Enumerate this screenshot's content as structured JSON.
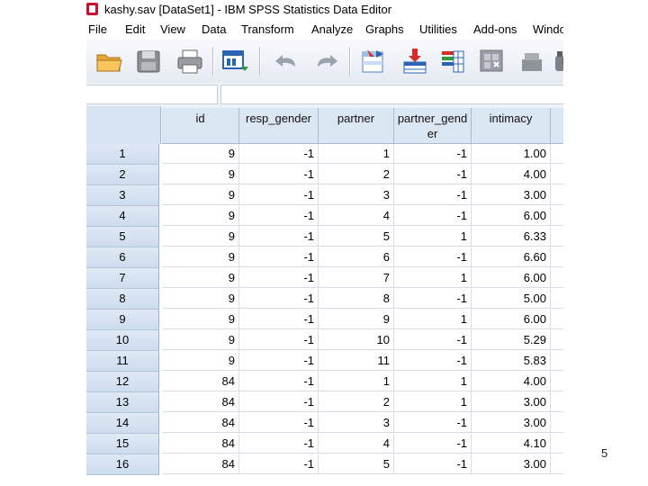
{
  "window": {
    "title": "kashy.sav [DataSet1] - IBM SPSS Statistics Data Editor"
  },
  "menubar": {
    "items": [
      "File",
      "Edit",
      "View",
      "Data",
      "Transform",
      "Analyze",
      "Graphs",
      "Utilities",
      "Add-ons",
      "Windo"
    ]
  },
  "toolbar": {
    "buttons": [
      "open-folder-icon",
      "save-disk-icon",
      "print-icon",
      "dialog-recall-icon",
      "undo-icon",
      "redo-icon",
      "goto-case-icon",
      "insert-cases-icon",
      "insert-variable-icon",
      "split-file-icon",
      "weight-cases-icon",
      "find-binoculars-icon"
    ]
  },
  "cellbar": {
    "reference": "",
    "value": ""
  },
  "grid": {
    "columns": [
      "id",
      "resp_gender",
      "partner",
      "partner_gend er",
      "intimacy"
    ],
    "column_header_lines": [
      [
        "id"
      ],
      [
        "resp_gender"
      ],
      [
        "partner"
      ],
      [
        "partner_gend",
        "er"
      ],
      [
        "intimacy"
      ]
    ],
    "rows": [
      {
        "n": "1",
        "id": "9",
        "resp_gender": "-1",
        "partner": "1",
        "partner_gender": "-1",
        "intimacy": "1.00"
      },
      {
        "n": "2",
        "id": "9",
        "resp_gender": "-1",
        "partner": "2",
        "partner_gender": "-1",
        "intimacy": "4.00"
      },
      {
        "n": "3",
        "id": "9",
        "resp_gender": "-1",
        "partner": "3",
        "partner_gender": "-1",
        "intimacy": "3.00"
      },
      {
        "n": "4",
        "id": "9",
        "resp_gender": "-1",
        "partner": "4",
        "partner_gender": "-1",
        "intimacy": "6.00"
      },
      {
        "n": "5",
        "id": "9",
        "resp_gender": "-1",
        "partner": "5",
        "partner_gender": "1",
        "intimacy": "6.33"
      },
      {
        "n": "6",
        "id": "9",
        "resp_gender": "-1",
        "partner": "6",
        "partner_gender": "-1",
        "intimacy": "6.60"
      },
      {
        "n": "7",
        "id": "9",
        "resp_gender": "-1",
        "partner": "7",
        "partner_gender": "1",
        "intimacy": "6.00"
      },
      {
        "n": "8",
        "id": "9",
        "resp_gender": "-1",
        "partner": "8",
        "partner_gender": "-1",
        "intimacy": "5.00"
      },
      {
        "n": "9",
        "id": "9",
        "resp_gender": "-1",
        "partner": "9",
        "partner_gender": "1",
        "intimacy": "6.00"
      },
      {
        "n": "10",
        "id": "9",
        "resp_gender": "-1",
        "partner": "10",
        "partner_gender": "-1",
        "intimacy": "5.29"
      },
      {
        "n": "11",
        "id": "9",
        "resp_gender": "-1",
        "partner": "11",
        "partner_gender": "-1",
        "intimacy": "5.83"
      },
      {
        "n": "12",
        "id": "84",
        "resp_gender": "-1",
        "partner": "1",
        "partner_gender": "1",
        "intimacy": "4.00"
      },
      {
        "n": "13",
        "id": "84",
        "resp_gender": "-1",
        "partner": "2",
        "partner_gender": "1",
        "intimacy": "3.00"
      },
      {
        "n": "14",
        "id": "84",
        "resp_gender": "-1",
        "partner": "3",
        "partner_gender": "-1",
        "intimacy": "3.00"
      },
      {
        "n": "15",
        "id": "84",
        "resp_gender": "-1",
        "partner": "4",
        "partner_gender": "-1",
        "intimacy": "4.10"
      },
      {
        "n": "16",
        "id": "84",
        "resp_gender": "-1",
        "partner": "5",
        "partner_gender": "-1",
        "intimacy": "3.00"
      }
    ]
  },
  "slide": {
    "number": "5"
  },
  "colors": {
    "header_bg": "#dbe6f3",
    "row_header_bg": "#d4e1f1",
    "grid_line": "#d6dde6",
    "toolbar_bg": "#eef2f7"
  }
}
